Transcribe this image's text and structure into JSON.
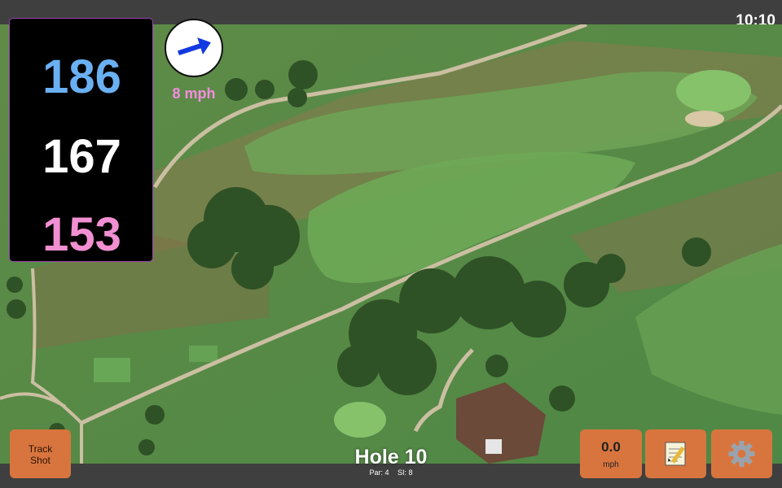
{
  "status": {
    "clock": "10:10"
  },
  "distances": {
    "back": "186",
    "middle": "167",
    "front": "153"
  },
  "wind": {
    "speed": "8 mph",
    "icon": "wind-arrow-icon",
    "arrow_color": "#1238e0"
  },
  "hole": {
    "title": "Hole 10",
    "par": "Par: 4",
    "si": "SI: 8"
  },
  "buttons": {
    "track_line1": "Track",
    "track_line2": "Shot",
    "speed_value": "0.0",
    "speed_unit": "mph",
    "notes_icon": "notepad-icon",
    "settings_icon": "gear-icon"
  },
  "colors": {
    "back_distance": "#6ab0f3",
    "middle_distance": "#ffffff",
    "front_distance": "#f28fd2",
    "button": "#d8753e",
    "box_border": "#9b3fb5"
  }
}
